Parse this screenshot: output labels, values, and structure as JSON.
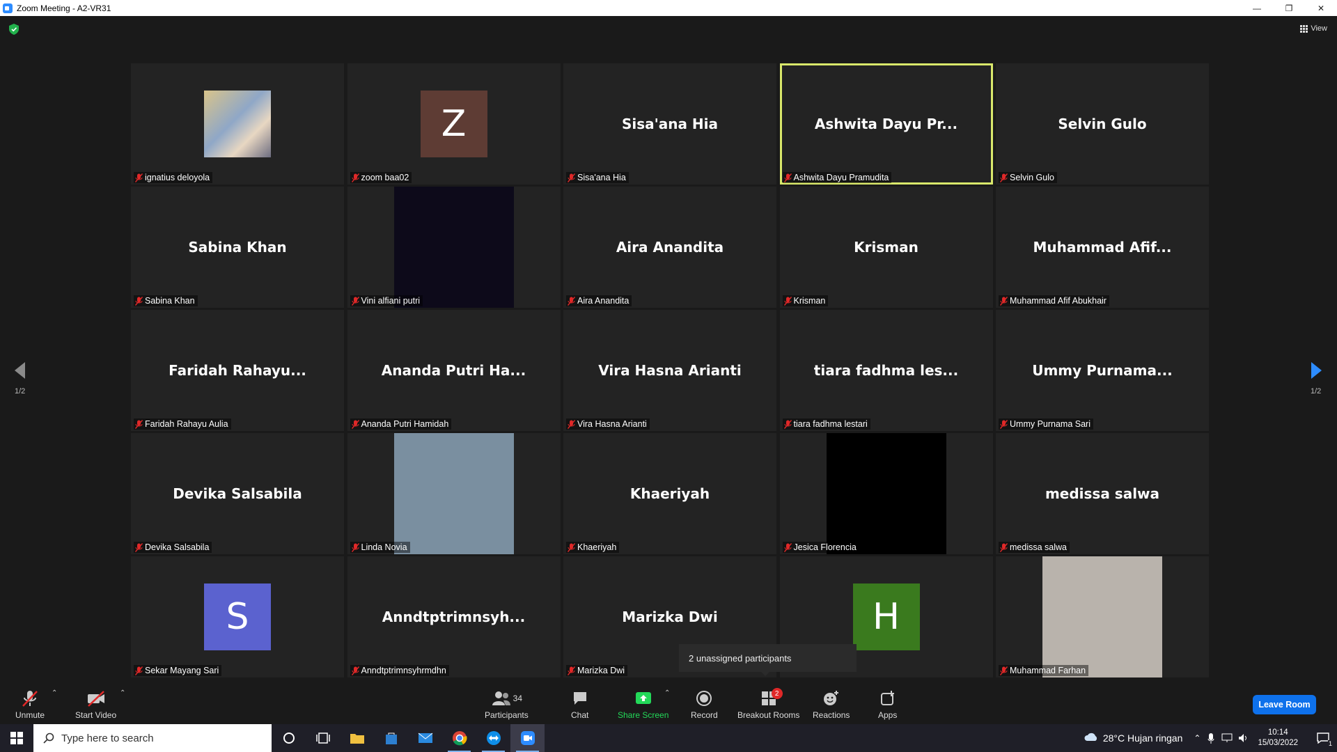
{
  "window": {
    "title": "Zoom Meeting - A2-VR31"
  },
  "top": {
    "view_label": "View"
  },
  "tiles": [
    {
      "label": "ignatius deloyola",
      "display": "photo"
    },
    {
      "label": "zoom baa02",
      "display": "avatar",
      "initial": "Z",
      "color": "#5e3c34"
    },
    {
      "label": "Sisa'ana Hia",
      "display": "name",
      "name": "Sisa'ana Hia"
    },
    {
      "label": "Ashwita Dayu Pramudita",
      "display": "name",
      "name": "Ashwita Dayu Pr...",
      "active": true
    },
    {
      "label": "Selvin Gulo",
      "display": "name",
      "name": "Selvin Gulo"
    },
    {
      "label": "Sabina Khan",
      "display": "name",
      "name": "Sabina Khan"
    },
    {
      "label": "Vini alfiani putri",
      "display": "video",
      "video_color": "#0d0a1a"
    },
    {
      "label": "Aira Anandita",
      "display": "name",
      "name": "Aira Anandita"
    },
    {
      "label": "Krisman",
      "display": "name",
      "name": "Krisman"
    },
    {
      "label": "Muhammad Afif Abukhair",
      "display": "name",
      "name": "Muhammad  Afif..."
    },
    {
      "label": "Faridah Rahayu Aulia",
      "display": "name",
      "name": "Faridah  Rahayu..."
    },
    {
      "label": "Ananda Putri Hamidah",
      "display": "name",
      "name": "Ananda  Putri  Ha..."
    },
    {
      "label": "Vira Hasna Arianti",
      "display": "name",
      "name": "Vira Hasna Arianti"
    },
    {
      "label": "tiara fadhma lestari",
      "display": "name",
      "name": "tiara  fadhma  les..."
    },
    {
      "label": "Ummy Purnama Sari",
      "display": "name",
      "name": "Ummy  Purnama..."
    },
    {
      "label": "Devika Salsabila",
      "display": "name",
      "name": "Devika Salsabila"
    },
    {
      "label": "Linda Novia",
      "display": "video",
      "video_color": "#7a8fa0"
    },
    {
      "label": "Khaeriyah",
      "display": "name",
      "name": "Khaeriyah"
    },
    {
      "label": "Jesica Florencia",
      "display": "video",
      "video_color": "#000000"
    },
    {
      "label": "medissa salwa",
      "display": "name",
      "name": "medissa salwa"
    },
    {
      "label": "Sekar Mayang Sari",
      "display": "avatar",
      "initial": "S",
      "color": "#5b62cf"
    },
    {
      "label": "Anndtptrimnsyhrmdhn",
      "display": "name",
      "name": "Anndtptrimnsyh..."
    },
    {
      "label": "Marizka Dwi",
      "display": "name",
      "name": "Marizka Dwi"
    },
    {
      "label": "",
      "display": "avatar",
      "initial": "H",
      "color": "#3a7a1e"
    },
    {
      "label": "Muhammad Farhan",
      "display": "video",
      "video_color": "#b9b3ac"
    }
  ],
  "pager": {
    "left": "1/2",
    "right": "1/2"
  },
  "popup": {
    "unassigned": "2 unassigned participants"
  },
  "toolbar": {
    "unmute": "Unmute",
    "start_video": "Start Video",
    "participants": "Participants",
    "participants_count": "34",
    "chat": "Chat",
    "share_screen": "Share Screen",
    "record": "Record",
    "breakout_rooms": "Breakout Rooms",
    "breakout_badge": "2",
    "reactions": "Reactions",
    "apps": "Apps",
    "leave": "Leave Room"
  },
  "taskbar": {
    "search_placeholder": "Type here to search",
    "weather": "28°C  Hujan ringan",
    "time": "10:14",
    "date": "15/03/2022",
    "notification_count": "1"
  },
  "colors": {
    "accent": "#0e71eb",
    "active_speaker": "#d9e86b",
    "share_green": "#23d959",
    "muted_red": "#e02828"
  }
}
